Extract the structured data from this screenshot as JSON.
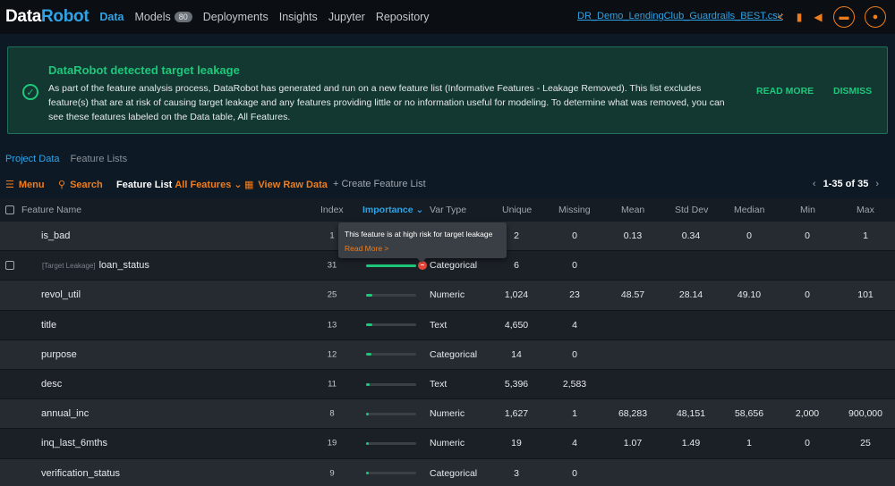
{
  "nav": {
    "logo_a": "Data",
    "logo_b": "Robot",
    "items": [
      {
        "label": "Data",
        "active": true
      },
      {
        "label": "Models",
        "badge": "80"
      },
      {
        "label": "Deployments"
      },
      {
        "label": "Insights"
      },
      {
        "label": "Jupyter"
      },
      {
        "label": "Repository"
      }
    ],
    "filename": "DR_Demo_LendingClub_Guardrails_BEST.csv",
    "icons": [
      "share-icon",
      "book-icon",
      "megaphone-icon",
      "folder-icon",
      "user-icon"
    ]
  },
  "banner": {
    "title": "DataRobot detected target leakage",
    "body": "As part of the feature analysis process, DataRobot has generated and run on a new feature list (Informative Features - Leakage Removed). This list excludes feature(s) that are at risk of causing target leakage and any features providing little or no information useful for modeling. To determine what was removed, you can see these features labeled on the Data table, All Features.",
    "read_more": "READ MORE",
    "dismiss": "DISMISS",
    "accent": "#1ec77a"
  },
  "tabs": [
    "Project Data",
    "Feature Lists"
  ],
  "toolbar": {
    "menu": "Menu",
    "search": "Search",
    "feature_list_label": "Feature List",
    "feature_list_value": "All Features",
    "view_raw": "View Raw Data",
    "create": "+ Create Feature List",
    "pager": "1-35 of 35"
  },
  "table": {
    "headers": [
      "Feature Name",
      "Index",
      "Importance",
      "Var Type",
      "Unique",
      "Missing",
      "Mean",
      "Std Dev",
      "Median",
      "Min",
      "Max"
    ],
    "rows": [
      {
        "name": "is_bad",
        "tag": "",
        "index": "1",
        "importance": 0,
        "type": "",
        "unique": "2",
        "missing": "0",
        "mean": "0.13",
        "std": "0.34",
        "median": "0",
        "min": "0",
        "max": "1",
        "checkbox": false
      },
      {
        "name": "loan_status",
        "tag": "[Target Leakage]",
        "index": "31",
        "importance": 1.0,
        "type": "Categorical",
        "unique": "6",
        "missing": "0",
        "mean": "",
        "std": "",
        "median": "",
        "min": "",
        "max": "",
        "checkbox": true,
        "warn": true
      },
      {
        "name": "revol_util",
        "tag": "",
        "index": "25",
        "importance": 0.12,
        "type": "Numeric",
        "unique": "1,024",
        "missing": "23",
        "mean": "48.57",
        "std": "28.14",
        "median": "49.10",
        "min": "0",
        "max": "101",
        "checkbox": false
      },
      {
        "name": "title",
        "tag": "",
        "index": "13",
        "importance": 0.12,
        "type": "Text",
        "unique": "4,650",
        "missing": "4",
        "mean": "",
        "std": "",
        "median": "",
        "min": "",
        "max": "",
        "checkbox": false
      },
      {
        "name": "purpose",
        "tag": "",
        "index": "12",
        "importance": 0.1,
        "type": "Categorical",
        "unique": "14",
        "missing": "0",
        "mean": "",
        "std": "",
        "median": "",
        "min": "",
        "max": "",
        "checkbox": false
      },
      {
        "name": "desc",
        "tag": "",
        "index": "11",
        "importance": 0.07,
        "type": "Text",
        "unique": "5,396",
        "missing": "2,583",
        "mean": "",
        "std": "",
        "median": "",
        "min": "",
        "max": "",
        "checkbox": false
      },
      {
        "name": "annual_inc",
        "tag": "",
        "index": "8",
        "importance": 0.06,
        "type": "Numeric",
        "unique": "1,627",
        "missing": "1",
        "mean": "68,283",
        "std": "48,151",
        "median": "58,656",
        "min": "2,000",
        "max": "900,000",
        "checkbox": false
      },
      {
        "name": "inq_last_6mths",
        "tag": "",
        "index": "19",
        "importance": 0.06,
        "type": "Numeric",
        "unique": "19",
        "missing": "4",
        "mean": "1.07",
        "std": "1.49",
        "median": "1",
        "min": "0",
        "max": "25",
        "checkbox": false
      },
      {
        "name": "verification_status",
        "tag": "",
        "index": "9",
        "importance": 0.06,
        "type": "Categorical",
        "unique": "3",
        "missing": "0",
        "mean": "",
        "std": "",
        "median": "",
        "min": "",
        "max": "",
        "checkbox": false
      }
    ]
  },
  "tooltip": {
    "text": "This feature is at high risk for target leakage",
    "link": "Read More >"
  }
}
